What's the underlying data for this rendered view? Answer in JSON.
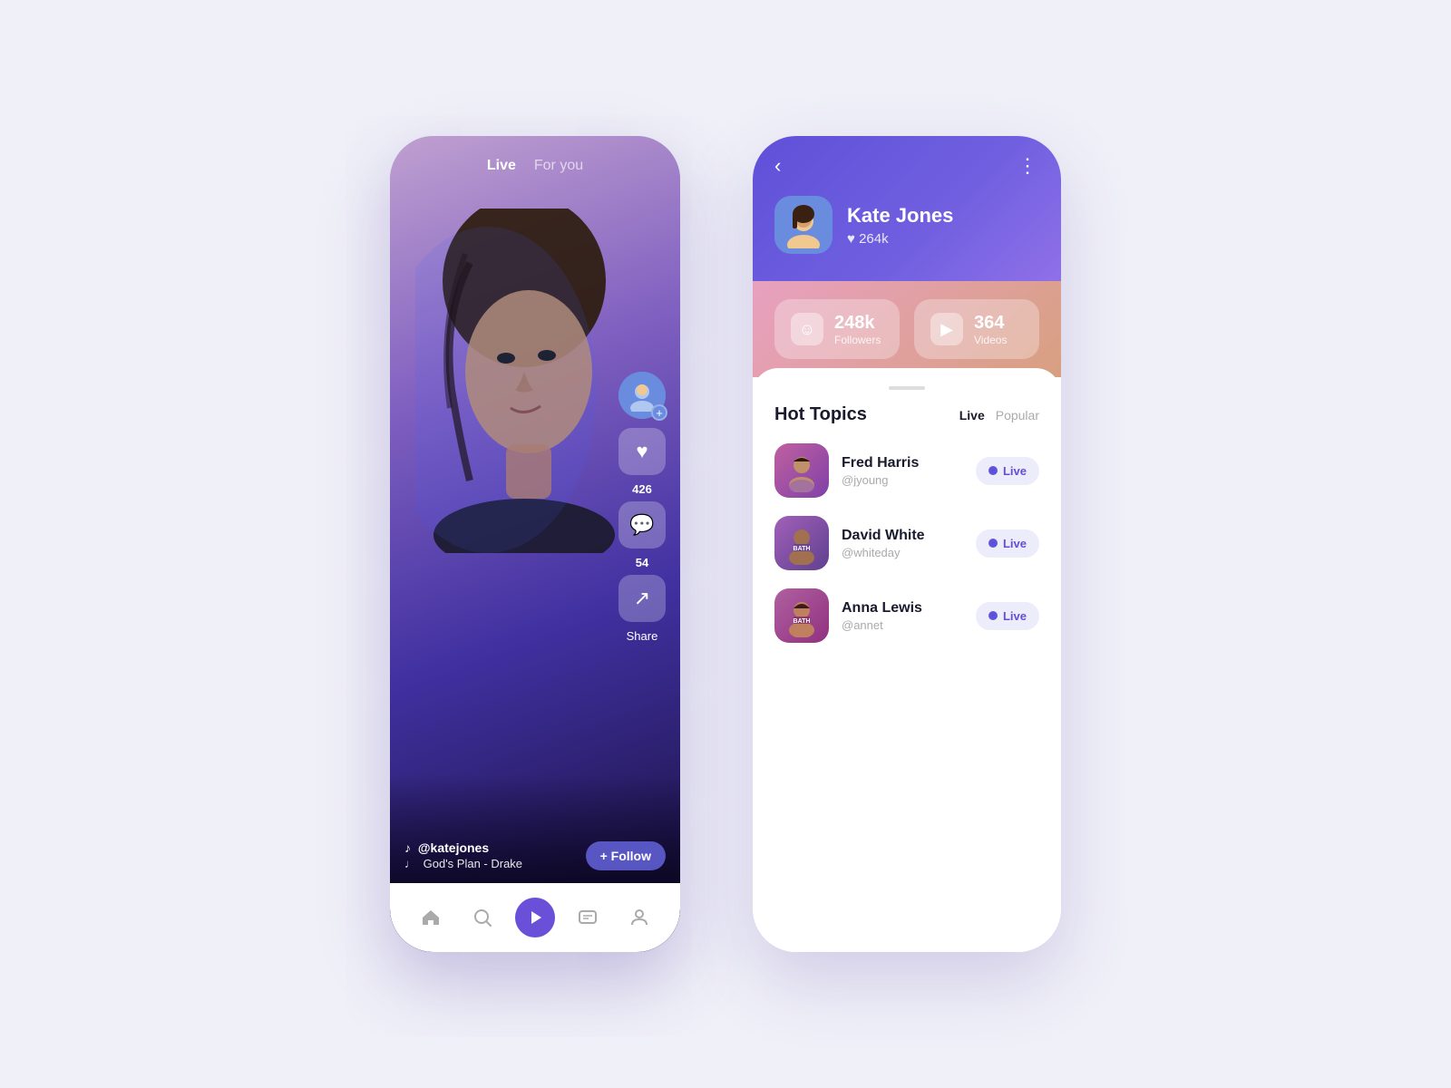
{
  "left_phone": {
    "nav": {
      "live": "Live",
      "for_you": "For you"
    },
    "action_buttons": {
      "likes": "426",
      "comments": "54",
      "share_label": "Share"
    },
    "bottom_info": {
      "handle": "@katejones",
      "song": "God's Plan - Drake"
    },
    "follow_button": "+ Follow",
    "bottom_nav": {
      "home_icon": "⌂",
      "search_icon": "○",
      "play_icon": "▶",
      "chat_icon": "⬜",
      "profile_icon": "◯"
    }
  },
  "right_phone": {
    "header": {
      "back_label": "‹",
      "more_label": "⋮",
      "name": "Kate Jones",
      "likes": "♥ 264k"
    },
    "stats": {
      "followers_count": "248k",
      "followers_label": "Followers",
      "videos_count": "364",
      "videos_label": "Videos"
    },
    "hot_topics": {
      "title": "Hot Topics",
      "tab_live": "Live",
      "tab_popular": "Popular",
      "items": [
        {
          "name": "Fred Harris",
          "handle": "@jyoung",
          "badge": "Live"
        },
        {
          "name": "David White",
          "handle": "@whiteday",
          "badge": "Live"
        },
        {
          "name": "Anna Lewis",
          "handle": "@annet",
          "badge": "Live"
        }
      ]
    }
  }
}
